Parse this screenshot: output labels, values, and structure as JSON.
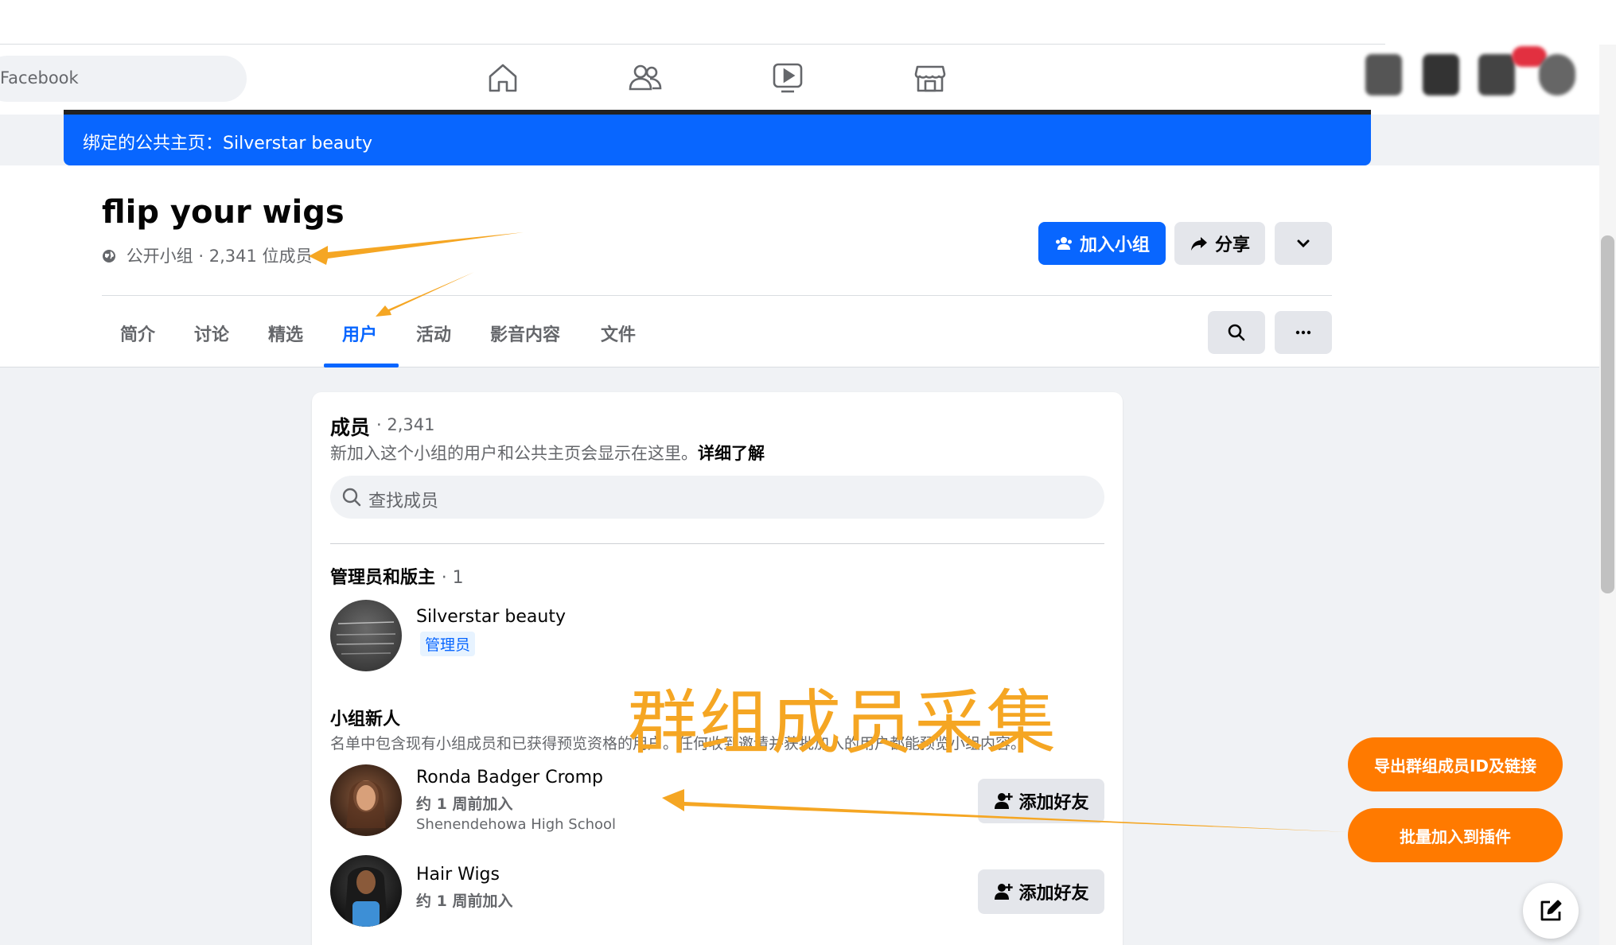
{
  "nav": {
    "search_text": "Facebook",
    "icons": [
      "home-icon",
      "friends-icon",
      "video-icon",
      "marketplace-icon"
    ]
  },
  "banner": {
    "text": "绑定的公共主页：Silverstar beauty"
  },
  "group": {
    "name": "flip your wigs",
    "privacy": "公开小组",
    "member_count_text": "2,341 位成员",
    "join_label": "加入小组",
    "share_label": "分享"
  },
  "tabs": [
    {
      "label": "简介",
      "active": false
    },
    {
      "label": "讨论",
      "active": false
    },
    {
      "label": "精选",
      "active": false
    },
    {
      "label": "用户",
      "active": true
    },
    {
      "label": "活动",
      "active": false
    },
    {
      "label": "影音内容",
      "active": false
    },
    {
      "label": "文件",
      "active": false
    }
  ],
  "members": {
    "title": "成员",
    "count": "· 2,341",
    "description": "新加入这个小组的用户和公共主页会显示在这里。",
    "learn_more": "详细了解",
    "search_placeholder": "查找成员"
  },
  "admins": {
    "title": "管理员和版主",
    "count": "· 1",
    "items": [
      {
        "name": "Silverstar beauty",
        "badge": "管理员"
      }
    ]
  },
  "new_members": {
    "title": "小组新人",
    "description": "名单中包含现有小组成员和已获得预览资格的用户。任何收到邀请并获批加入的用户都能预览小组内容。",
    "add_friend_label": "添加好友",
    "items": [
      {
        "name": "Ronda Badger Cromp",
        "joined": "约 1 周前加入",
        "school": "Shenendehowa High School"
      },
      {
        "name": "Hair Wigs",
        "joined": "约 1 周前加入"
      }
    ]
  },
  "overlay": {
    "caption": "群组成员采集",
    "export_button": "导出群组成员ID及链接",
    "batch_button": "批量加入到插件"
  },
  "colors": {
    "brand_blue": "#0866ff",
    "accent_orange": "#ff7a00",
    "caption_orange": "#f5a623"
  }
}
